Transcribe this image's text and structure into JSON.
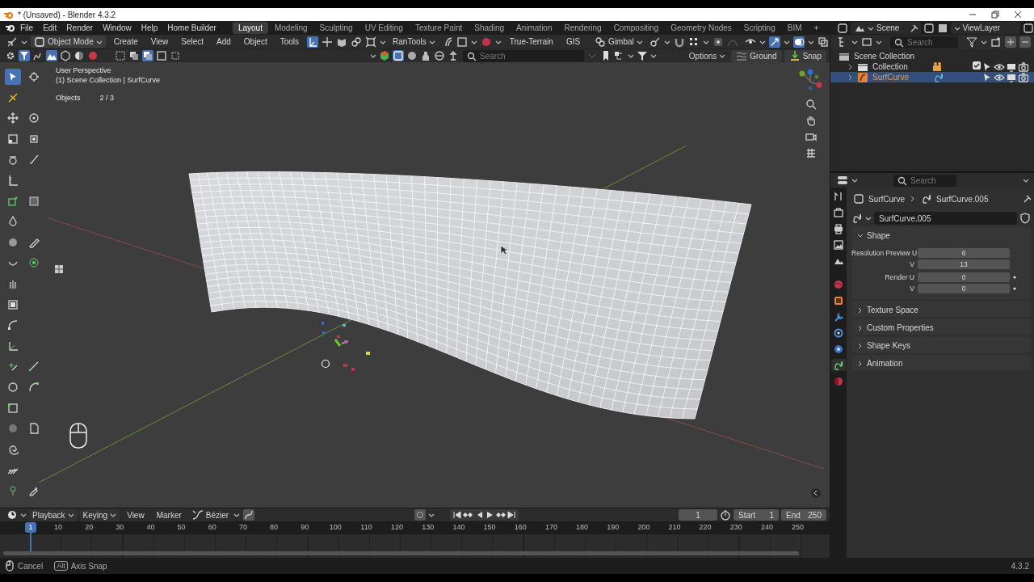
{
  "window": {
    "title": "* (Unsaved) - Blender 4.3.2"
  },
  "menu": [
    "File",
    "Edit",
    "Render",
    "Window",
    "Help",
    "Home Builder"
  ],
  "workspaces": [
    {
      "label": "Layout",
      "selected": true
    },
    {
      "label": "Modeling",
      "selected": false
    },
    {
      "label": "Sculpting",
      "selected": false
    },
    {
      "label": "UV Editing",
      "selected": false
    },
    {
      "label": "Texture Paint",
      "selected": false
    },
    {
      "label": "Shading",
      "selected": false
    },
    {
      "label": "Animation",
      "selected": false
    },
    {
      "label": "Rendering",
      "selected": false
    },
    {
      "label": "Compositing",
      "selected": false
    },
    {
      "label": "Geometry Nodes",
      "selected": false
    },
    {
      "label": "Scripting",
      "selected": false
    },
    {
      "label": "BIM",
      "selected": false
    }
  ],
  "add_workspace": "+",
  "scene": "Scene",
  "view_layer": "ViewLayer",
  "tool_header": {
    "mode": "Object Mode",
    "menus": [
      "Create",
      "View",
      "Select",
      "Add",
      "Object",
      "Tools"
    ],
    "addon_menu": "RanTools",
    "addons": [
      "True-Terrain",
      "GIS"
    ],
    "orientation": "Gimbal"
  },
  "viewport_header": {
    "search_placeholder": "Search",
    "options": "Options",
    "ground": "Ground",
    "snap": "Snap"
  },
  "viewport": {
    "view_name": "User Perspective",
    "collection": "(1) Scene Collection | SurfCurve",
    "stats": [
      {
        "label": "Objects",
        "value": "2 / 3"
      }
    ]
  },
  "outliner": {
    "search_placeholder": "Search",
    "tree": [
      {
        "label": "Scene Collection",
        "kind": "scene",
        "selected": false,
        "children": [
          {
            "label": "Collection",
            "kind": "collection",
            "selected": false,
            "checked": true
          },
          {
            "label": "SurfCurve",
            "kind": "object",
            "selected": true
          }
        ]
      }
    ]
  },
  "properties": {
    "search_placeholder": "Search",
    "tabs": [
      {
        "selected": false
      },
      {
        "selected": false
      },
      {
        "selected": false
      },
      {
        "selected": false
      },
      {
        "selected": false
      },
      {
        "selected": false
      },
      {
        "selected": false
      },
      {
        "selected": false
      },
      {
        "selected": false
      },
      {
        "selected": false
      },
      {
        "selected": true
      },
      {
        "selected": false
      }
    ],
    "breadcrumb": [
      "SurfCurve",
      "SurfCurve.005"
    ],
    "datablock": "SurfCurve.005",
    "panels": [
      {
        "title": "Shape",
        "expanded": true,
        "groups": [
          [
            {
              "label": "Resolution Preview U",
              "value": "6",
              "decorator": false
            },
            {
              "label": "V",
              "value": "13",
              "decorator": false
            }
          ],
          [
            {
              "label": "Render U",
              "value": "0",
              "decorator": true
            },
            {
              "label": "V",
              "value": "0",
              "decorator": true
            }
          ]
        ]
      },
      {
        "title": "Texture Space",
        "expanded": false
      },
      {
        "title": "Custom Properties",
        "expanded": false
      },
      {
        "title": "Shape Keys",
        "expanded": false
      },
      {
        "title": "Animation",
        "expanded": false
      }
    ]
  },
  "timeline": {
    "menus": [
      "Playback",
      "Keying",
      "View",
      "Marker"
    ],
    "interpolation": "Bézier",
    "current_frame": "1",
    "start_label": "Start",
    "start": "1",
    "end_label": "End",
    "end": "250",
    "playhead": "1",
    "ruler": [
      "10",
      "20",
      "30",
      "40",
      "50",
      "60",
      "70",
      "80",
      "90",
      "100",
      "110",
      "120",
      "130",
      "140",
      "150",
      "160",
      "170",
      "180",
      "190",
      "200",
      "210",
      "220",
      "230",
      "240",
      "250"
    ]
  },
  "status_bar": {
    "hints": [
      {
        "kind": "mouse",
        "label": "Cancel"
      },
      {
        "kind": "key",
        "key": "Alt",
        "label": "Axis Snap"
      }
    ],
    "version": "4.3.2"
  }
}
